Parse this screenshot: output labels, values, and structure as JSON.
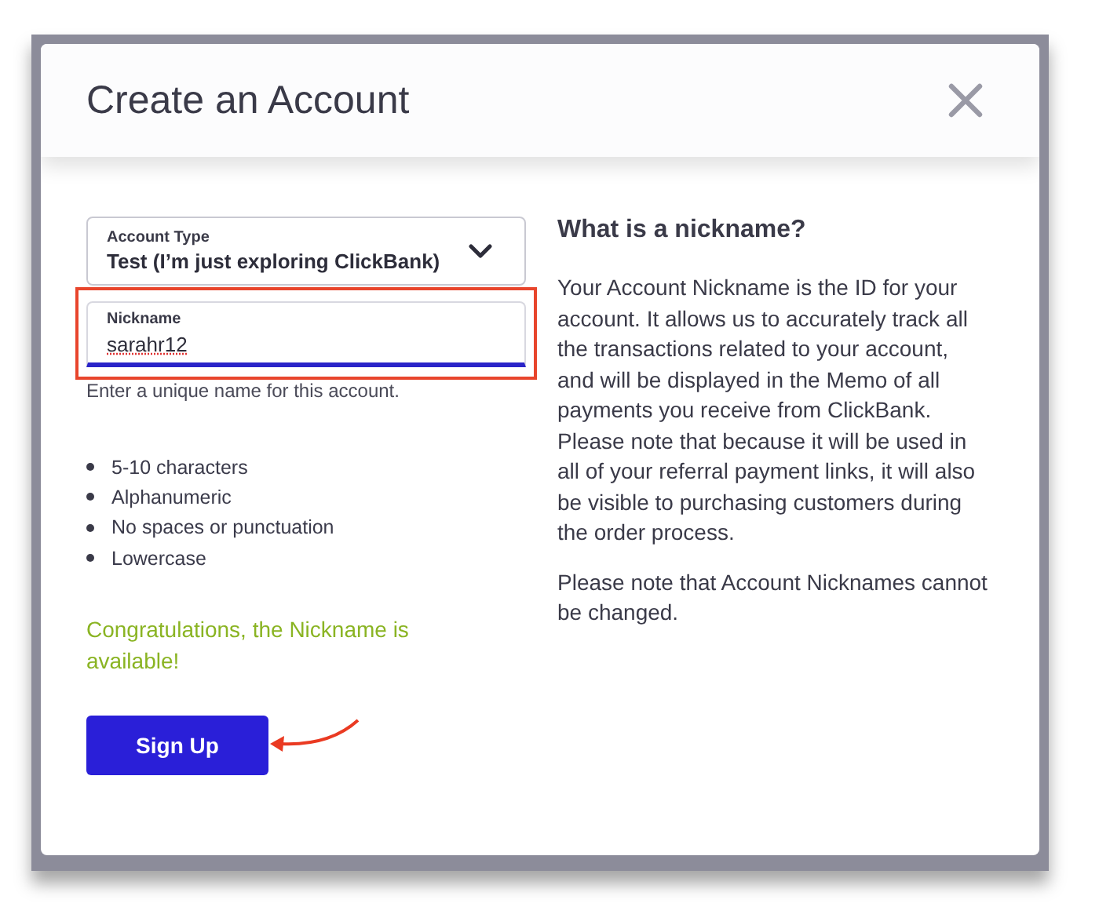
{
  "dialog": {
    "title": "Create an Account"
  },
  "account_type": {
    "label": "Account Type",
    "value": "Test (I’m just exploring ClickBank)"
  },
  "nickname": {
    "label": "Nickname",
    "value": "sarahr12",
    "misspelled": true,
    "focused": true,
    "hint": "Enter a unique name for this account."
  },
  "rules": [
    "5-10 characters",
    "Alphanumeric",
    "No spaces or punctuation",
    "Lowercase"
  ],
  "availability": {
    "message": "Congratulations, the Nickname is available!",
    "available": true
  },
  "submit": {
    "label": "Sign Up"
  },
  "help": {
    "title": "What is a nickname?",
    "paragraphs": [
      "Your Account Nickname is the ID for your account. It allows us to accurately track all the transactions related to your account, and will be displayed in the Memo of all payments you receive from ClickBank. Please note that because it will be used in all of your referral payment links, it will also be visible to purchasing customers during the order process.",
      "Please note that Account Nicknames cannot be changed."
    ]
  }
}
